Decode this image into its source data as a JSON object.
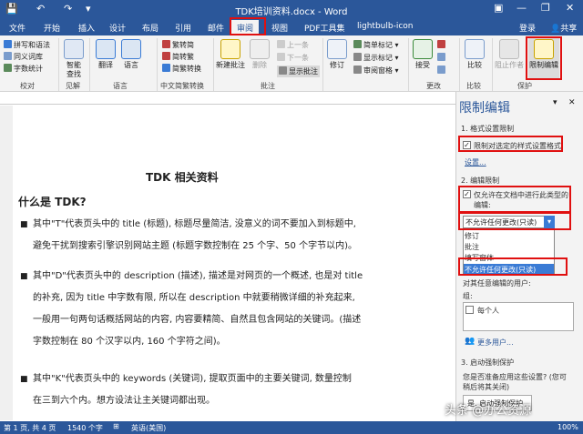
{
  "titlebar": {
    "title": "TDK培训资料.docx - Word",
    "window_buttons": [
      "—",
      "❐",
      "✕"
    ]
  },
  "tabs": [
    {
      "label": "文件"
    },
    {
      "label": "开始"
    },
    {
      "label": "插入"
    },
    {
      "label": "设计"
    },
    {
      "label": "布局"
    },
    {
      "label": "引用"
    },
    {
      "label": "邮件"
    },
    {
      "label": "审阅"
    },
    {
      "label": "视图"
    },
    {
      "label": "PDF工具集"
    }
  ],
  "tabs_right": {
    "login": "登录",
    "share": "共享",
    "help_icon": "lightbulb-icon"
  },
  "ribbon": {
    "proofing": {
      "spell": "拼写和语法",
      "thesaurus": "同义词库",
      "wordcount": "字数统计",
      "group": "校对"
    },
    "insights": {
      "smart_lookup": "智能\n查找",
      "group": "见解"
    },
    "language": {
      "translate": "翻译",
      "language": "语言",
      "group": "语言"
    },
    "chinese": {
      "to_trad": "繁转简",
      "to_simp": "简转繁",
      "convert": "简繁转换",
      "group": "中文简繁转换"
    },
    "comments": {
      "new": "新建批注",
      "delete": "删除",
      "prev": "上一条",
      "next": "下一条",
      "show": "显示批注",
      "group": "批注"
    },
    "tracking": {
      "track": "修订",
      "simple_markup": "简单标记",
      "show_markup": "显示标记",
      "reviewing_pane": "审阅窗格"
    },
    "changes": {
      "accept": "接受",
      "group": "更改"
    },
    "compare": {
      "compare": "比较",
      "group": "比较"
    },
    "protect": {
      "block_authors": "阻止作者",
      "restrict_editing": "限制编辑",
      "group": "保护"
    }
  },
  "document": {
    "title": "TDK 相关资料",
    "heading": "什么是 TDK?",
    "paragraphs": [
      {
        "line1": "其中\"T\"代表页头中的 title (标题), 标题尽量简洁, 没意义的词不要加入到标题中,",
        "line2": "避免干扰到搜索引擎识别网站主题 (标题字数控制在 25 个字、50 个字节以内)。"
      },
      {
        "line1": "其中\"D\"代表页头中的 description (描述), 描述是对网页的一个概述, 也是对 title",
        "line2": "的补充, 因为 title 中字数有限, 所以在 description 中就要稍微详细的补充起来,",
        "line3": "一般用一句两句话概括网站的内容, 内容要精简、自然且包含网站的关键词。(描述",
        "line4": "字数控制在 80 个汉字以内, 160 个字符之间)。"
      },
      {
        "line1": "其中\"K\"代表页头中的 keywords (关键词), 提取页面中的主要关键词, 数量控制",
        "line2": "在三到六个内。想方设法让主关键词都出现。"
      }
    ]
  },
  "pane": {
    "title": "限制编辑",
    "sec1_title": "1. 格式设置限制",
    "sec1_check": "限制对选定的样式设置格式",
    "sec1_link": "设置...",
    "sec2_title": "2. 编辑限制",
    "sec2_check": "仅允许在文档中进行此类型的编辑:",
    "dropdown_value": "不允许任何更改(只读)",
    "options": [
      "修订",
      "批注",
      "填写窗体",
      "不允许任何更改(只读)"
    ],
    "exceptions_label": "对其任意编辑的用户:",
    "groups_label": "组:",
    "everyone": "每个人",
    "more_users": "更多用户...",
    "sec3_title": "3. 启动强制保护",
    "sec3_text1": "您是否准备应用这些设置? (您可",
    "sec3_text2": "稍后将其关闭)",
    "enforce_button": "是, 启动强制保护"
  },
  "status": {
    "page": "第 1 页, 共 4 页",
    "words": "1540 个字",
    "lang": "英语(美国)",
    "watermark": "头条 @办公资源",
    "zoom": "100%"
  }
}
